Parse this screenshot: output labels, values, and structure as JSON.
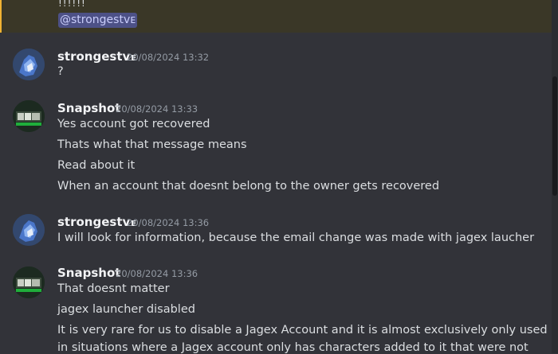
{
  "mention": {
    "dots": "!!!!!!",
    "text": "@strongestvᴇ"
  },
  "messages": [
    {
      "author": "strongestv",
      "tag": "E",
      "timestamp": "20/08/2024 13:32",
      "lines": [
        "?"
      ]
    },
    {
      "author": "Snapshot",
      "timestamp": "20/08/2024 13:33",
      "lines": [
        "Yes account got recovered",
        "Thats what that message means",
        "Read about it",
        "When an account that doesnt belong to the owner gets recovered"
      ]
    },
    {
      "author": "strongestv",
      "tag": "E",
      "timestamp": "20/08/2024 13:36",
      "lines": [
        "I will look for information, because the email change was made with jagex laucher"
      ]
    },
    {
      "author": "Snapshot",
      "timestamp": "20/08/2024 13:36",
      "lines": [
        "That doesnt matter",
        "jagex launcher disabled",
        "It is very rare for us to disable a Jagex Account and it is almost exclusively only used",
        "in situations where a Jagex account only has characters added to it that were not"
      ]
    }
  ]
}
